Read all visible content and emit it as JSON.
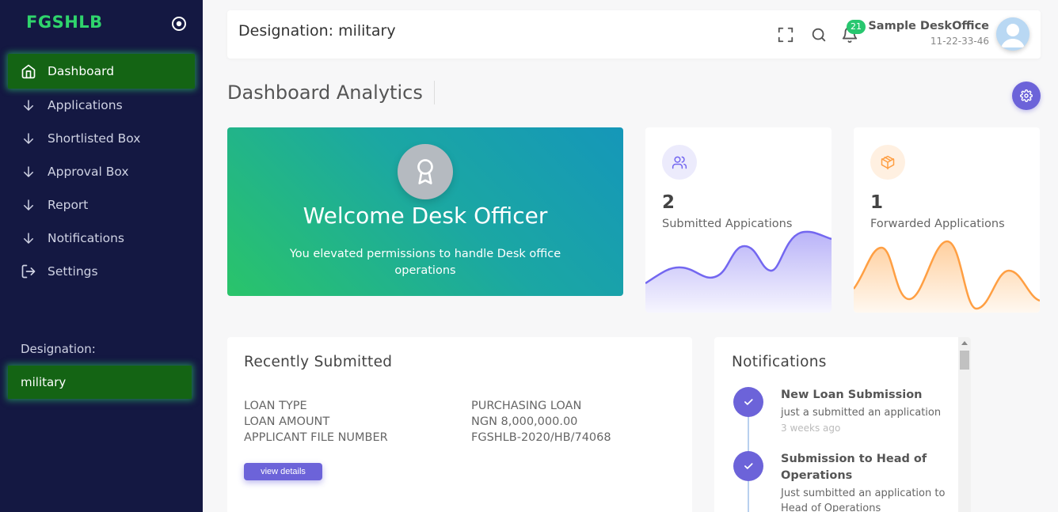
{
  "app": {
    "brand": "FGSHLB"
  },
  "sidebar": {
    "items": [
      {
        "label": "Dashboard",
        "icon": "home-icon",
        "active": true
      },
      {
        "label": "Applications",
        "icon": "arrow-down-icon"
      },
      {
        "label": "Shortlisted Box",
        "icon": "arrow-down-icon"
      },
      {
        "label": "Approval Box",
        "icon": "arrow-down-icon"
      },
      {
        "label": "Report",
        "icon": "arrow-down-icon"
      },
      {
        "label": "Notifications",
        "icon": "arrow-down-icon"
      },
      {
        "label": "Settings",
        "icon": "logout-icon"
      }
    ],
    "designation_label": "Designation:",
    "designation_value": "military"
  },
  "header": {
    "title": "Designation: military",
    "notification_count": "21",
    "user_name": "Sample DeskOffice",
    "user_id": "11-22-33-46"
  },
  "page": {
    "title": "Dashboard Analytics"
  },
  "welcome": {
    "title": "Welcome Desk Officer",
    "message": "You elevated permissions to handle Desk office operations"
  },
  "stats": [
    {
      "value": "2",
      "label": "Submitted Appications",
      "color": "#7367f0"
    },
    {
      "value": "1",
      "label": "Forwarded Applications",
      "color": "#ff9f43"
    }
  ],
  "recent": {
    "title": "Recently Submitted",
    "rows": [
      {
        "key": "LOAN TYPE",
        "value": "PURCHASING LOAN"
      },
      {
        "key": "LOAN AMOUNT",
        "value": "NGN 8,000,000.00"
      },
      {
        "key": "APPLICANT FILE NUMBER",
        "value": "FGSHLB-2020/HB/74068"
      }
    ],
    "button_label": "view details"
  },
  "notifications": {
    "title": "Notifications",
    "items": [
      {
        "title": "New Loan Submission",
        "desc": "just a submitted an application",
        "time": "3 weeks ago"
      },
      {
        "title": "Submission to Head of Operations",
        "desc": "Just sumbitted an application to Head of Operations"
      }
    ]
  },
  "colors": {
    "sidebar_bg": "#141842",
    "accent_green": "#2fd46c",
    "accent_purple": "#6c63d9",
    "badge_green": "#28c76f"
  }
}
